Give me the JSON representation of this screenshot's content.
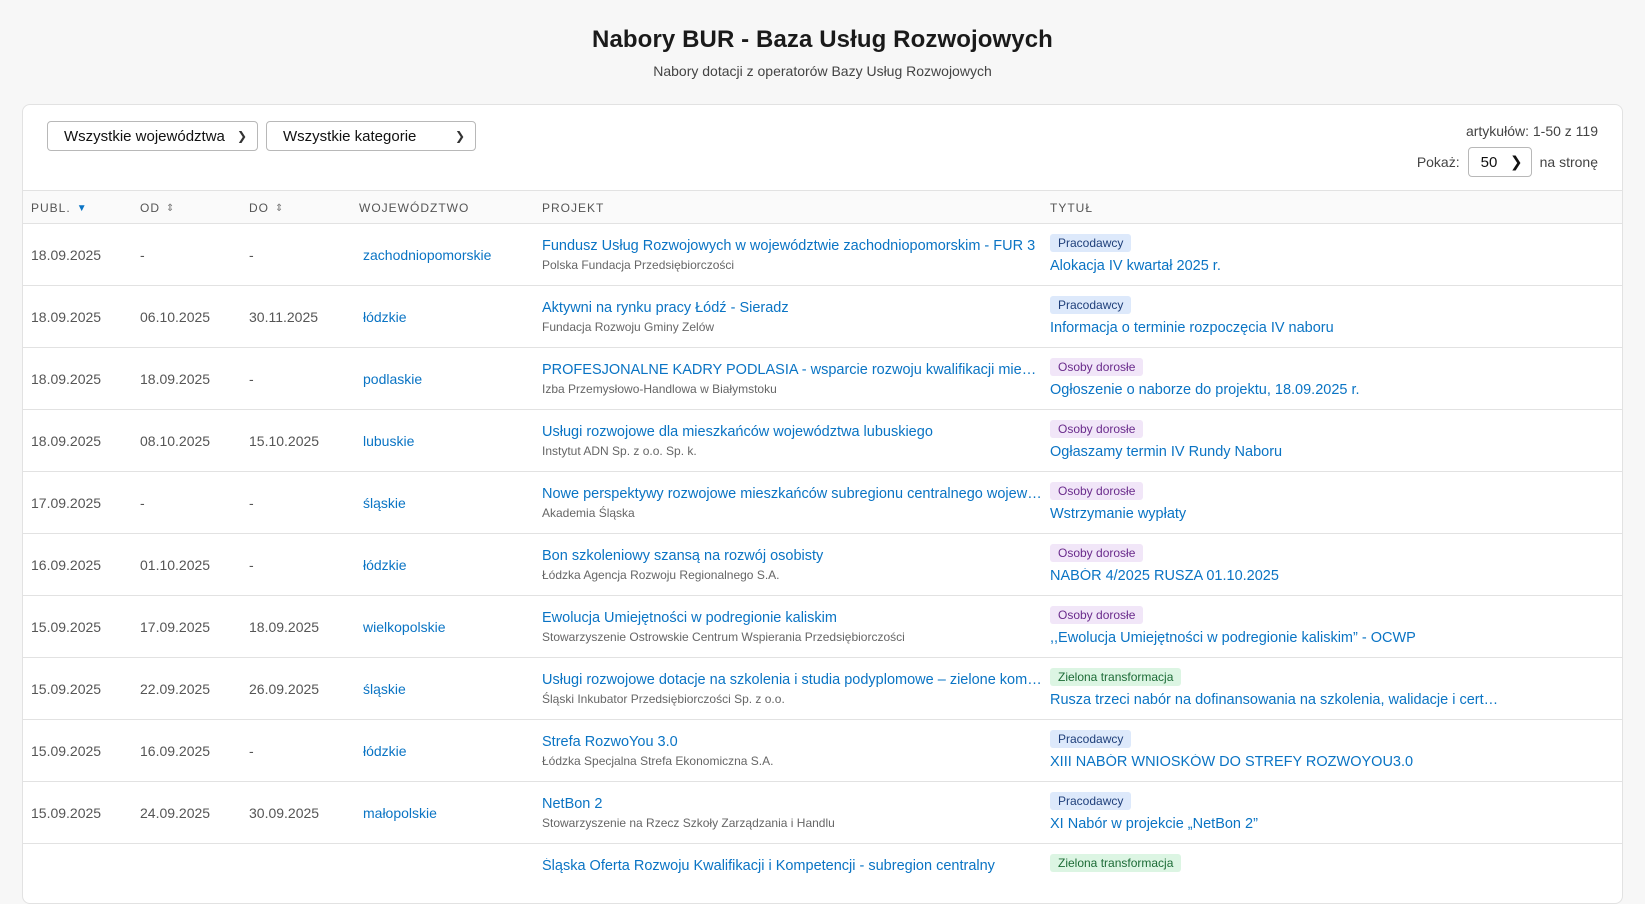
{
  "header": {
    "title": "Nabory BUR - Baza Usług Rozwojowych",
    "subtitle": "Nabory dotacji z operatorów Bazy Usług Rozwojowych"
  },
  "filters": {
    "region": "Wszystkie województwa",
    "category": "Wszystkie kategorie",
    "count": "artykułów: 1-50 z 119",
    "show_label": "Pokaż:",
    "show_value": "50",
    "per_page_label": "na stronę"
  },
  "columns": {
    "publ": "PUBL.",
    "od": "OD",
    "do": "DO",
    "woj": "WOJEWÓDZTWO",
    "proj": "PROJEKT",
    "tyt": "TYTUŁ"
  },
  "rows": [
    {
      "publ": "18.09.2025",
      "od": "-",
      "do": "-",
      "region": "zachodniopomorskie",
      "project": "Fundusz Usług Rozwojowych w województwie zachodniopomorskim - FUR 3",
      "org": "Polska Fundacja Przedsiębiorczości",
      "badge": "Pracodawcy",
      "badge_type": "prac",
      "title": "Alokacja IV kwartał 2025 r."
    },
    {
      "publ": "18.09.2025",
      "od": "06.10.2025",
      "do": "30.11.2025",
      "region": "łódzkie",
      "project": "Aktywni na rynku pracy Łódź - Sieradz",
      "org": "Fundacja Rozwoju Gminy Zelów",
      "badge": "Pracodawcy",
      "badge_type": "prac",
      "title": "Informacja o terminie rozpoczęcia IV naboru"
    },
    {
      "publ": "18.09.2025",
      "od": "18.09.2025",
      "do": "-",
      "region": "podlaskie",
      "project": "PROFESJONALNE KADRY PODLASIA - wsparcie rozwoju kwalifikacji mieszkańców",
      "org": "Izba Przemysłowo-Handlowa w Białymstoku",
      "badge": "Osoby dorosłe",
      "badge_type": "osoby",
      "title": "Ogłoszenie o naborze do projektu, 18.09.2025 r."
    },
    {
      "publ": "18.09.2025",
      "od": "08.10.2025",
      "do": "15.10.2025",
      "region": "lubuskie",
      "project": "Usługi rozwojowe dla mieszkańców województwa lubuskiego",
      "org": "Instytut ADN Sp. z o.o. Sp. k.",
      "badge": "Osoby dorosłe",
      "badge_type": "osoby",
      "title": "Ogłaszamy termin IV Rundy Naboru"
    },
    {
      "publ": "17.09.2025",
      "od": "-",
      "do": "-",
      "region": "śląskie",
      "project": "Nowe perspektywy rozwojowe mieszkańców subregionu centralnego województwa",
      "org": "Akademia Śląska",
      "badge": "Osoby dorosłe",
      "badge_type": "osoby",
      "title": "Wstrzymanie wypłaty"
    },
    {
      "publ": "16.09.2025",
      "od": "01.10.2025",
      "do": "-",
      "region": "łódzkie",
      "project": "Bon szkoleniowy szansą na rozwój osobisty",
      "org": "Łódzka Agencja Rozwoju Regionalnego S.A.",
      "badge": "Osoby dorosłe",
      "badge_type": "osoby",
      "title": "NABÓR 4/2025 RUSZA 01.10.2025"
    },
    {
      "publ": "15.09.2025",
      "od": "17.09.2025",
      "do": "18.09.2025",
      "region": "wielkopolskie",
      "project": "Ewolucja Umiejętności w podregionie kaliskim",
      "org": "Stowarzyszenie Ostrowskie Centrum Wspierania Przedsiębiorczości",
      "badge": "Osoby dorosłe",
      "badge_type": "osoby",
      "title": ",,Ewolucja Umiejętności w podregionie kaliskim” - OCWP"
    },
    {
      "publ": "15.09.2025",
      "od": "22.09.2025",
      "do": "26.09.2025",
      "region": "śląskie",
      "project": "Usługi rozwojowe dotacje na szkolenia i studia podyplomowe – zielone kompetencje",
      "org": "Śląski Inkubator Przedsiębiorczości Sp. z o.o.",
      "badge": "Zielona transformacja",
      "badge_type": "ziel",
      "title": "Rusza trzeci nabór na dofinansowania na szkolenia, walidacje i certyfikacje"
    },
    {
      "publ": "15.09.2025",
      "od": "16.09.2025",
      "do": "-",
      "region": "łódzkie",
      "project": "Strefa RozwoYou 3.0",
      "org": "Łódzka Specjalna Strefa Ekonomiczna S.A.",
      "badge": "Pracodawcy",
      "badge_type": "prac",
      "title": "XIII NABÓR WNIOSKÓW DO STREFY ROZWOYOU3.0"
    },
    {
      "publ": "15.09.2025",
      "od": "24.09.2025",
      "do": "30.09.2025",
      "region": "małopolskie",
      "project": "NetBon 2",
      "org": "Stowarzyszenie na Rzecz Szkoły Zarządzania i Handlu",
      "badge": "Pracodawcy",
      "badge_type": "prac",
      "title": "XI Nabór w projekcie „NetBon 2”"
    },
    {
      "publ": "",
      "od": "",
      "do": "",
      "region": "",
      "project": "Śląska Oferta Rozwoju Kwalifikacji i Kompetencji - subregion centralny",
      "org": "",
      "badge": "Zielona transformacja",
      "badge_type": "ziel",
      "title": ""
    }
  ]
}
